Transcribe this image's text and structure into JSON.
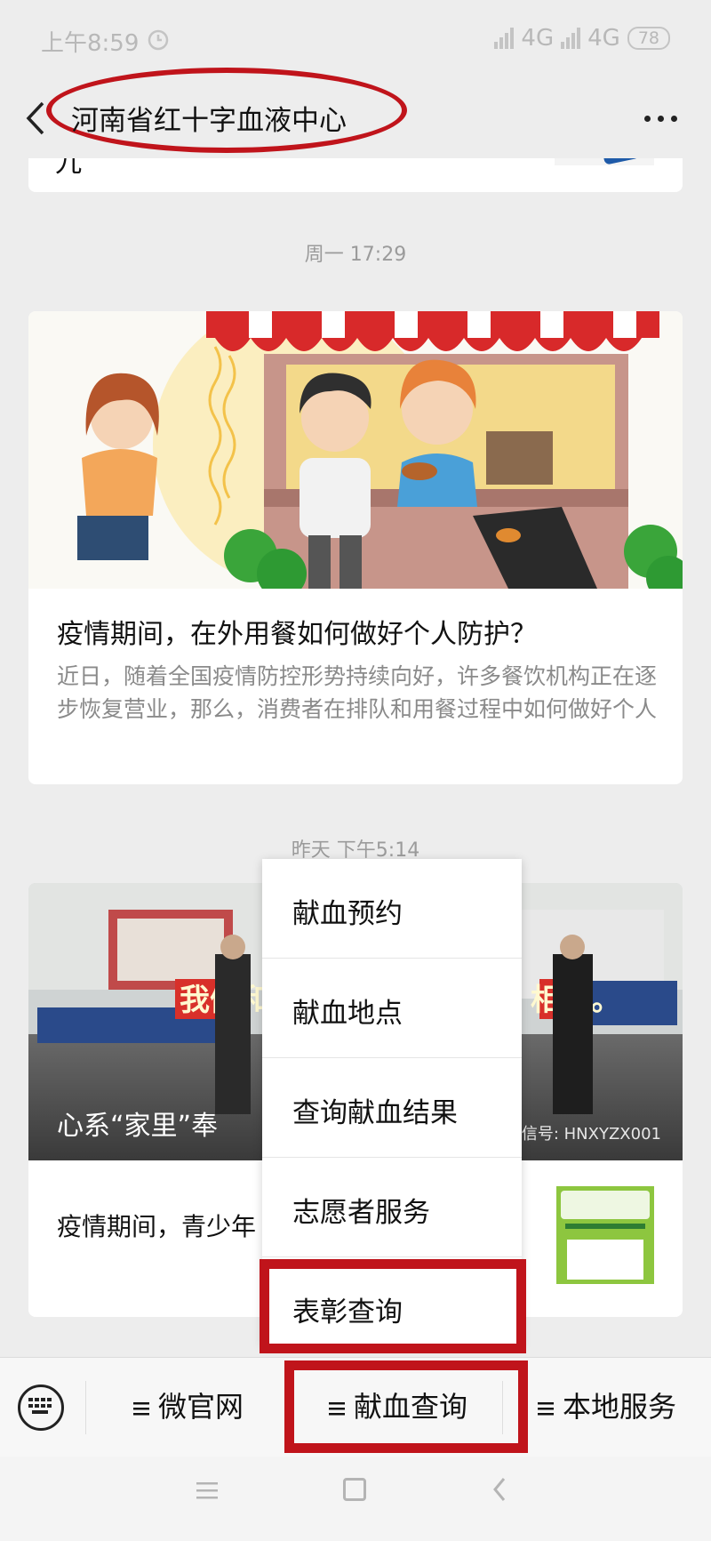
{
  "status_bar": {
    "time": "上午8:59",
    "network1": "4G",
    "network2": "4G",
    "battery": "78"
  },
  "header": {
    "title": "河南省红十字血液中心"
  },
  "chat": {
    "prev_fragment": "九",
    "timestamp1": "周一 17:29",
    "article1": {
      "title": "疫情期间，在外用餐如何做好个人防护？",
      "desc": "近日，随着全国疫情防控形势持续向好，许多餐饮机构正在逐步恢复营业，那么，消费者在排队和用餐过程中如何做好个人"
    },
    "timestamp2": "昨天 下午5:14",
    "article2": {
      "title": "心系“家里”奉",
      "banner_left": "我们和",
      "banner_right": "相连。",
      "watermark": "微信号: HNXYZX001",
      "sub_title": "疫情期间，青少年"
    }
  },
  "popup_menu": {
    "items": [
      "献血预约",
      "献血地点",
      "查询献血结果",
      "志愿者服务",
      "表彰查询"
    ]
  },
  "menu_bar": {
    "tabs": [
      "微官网",
      "献血查询",
      "本地服务"
    ]
  },
  "colors": {
    "highlight": "#c0141b",
    "background": "#ededed"
  }
}
